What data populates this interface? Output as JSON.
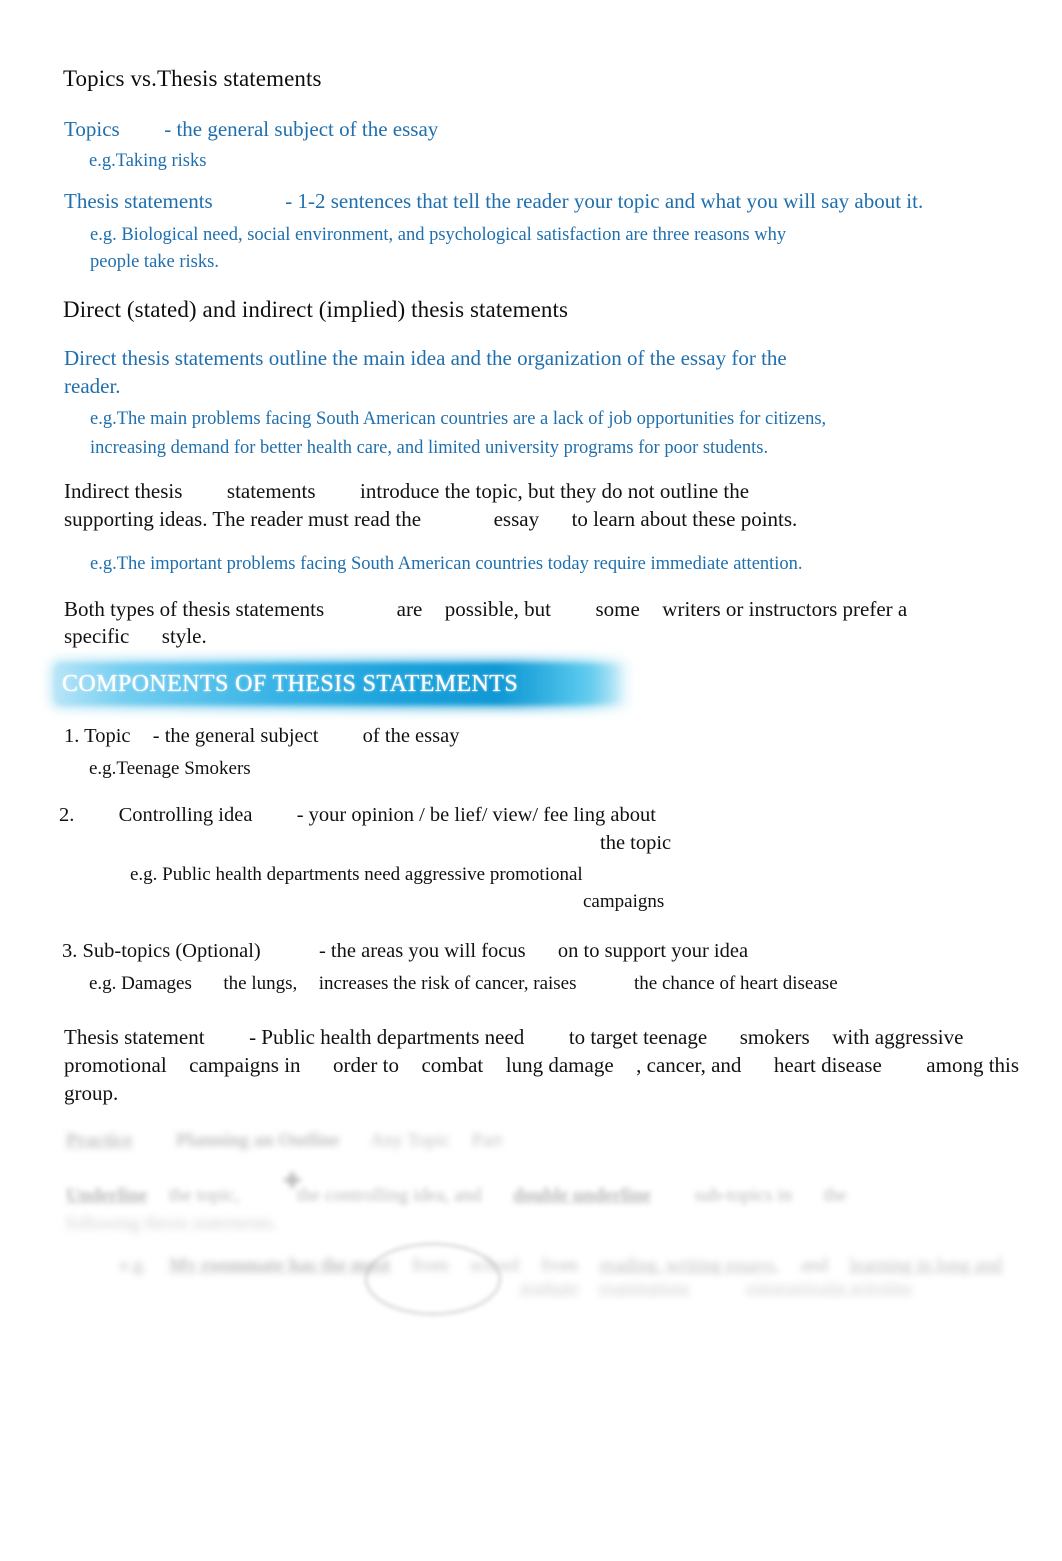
{
  "document": {
    "title": "Topics vs.Thesis statements",
    "accent_blue": "#1F6FAE",
    "banner_color_start": "#B6E4F7",
    "banner_color_end": "#1098D4",
    "text_color": "#111111"
  },
  "section_topics": {
    "heading": "Topics vs.Thesis statements",
    "topics_label": "Topics",
    "topics_definition": "- the general subject of the essay",
    "topics_example": "e.g.Taking risks",
    "thesis_label": "Thesis statements",
    "thesis_definition": "- 1-2 sentences that tell the reader your topic and what you will say about it.",
    "thesis_example_line1": "e.g. Biological need, social environment, and psychological satisfaction are three reasons why",
    "thesis_example_line2": "people take risks."
  },
  "section_direct_indirect": {
    "heading": "Direct (stated) and indirect (implied) thesis statements",
    "direct_line1": "Direct thesis statements outline the main idea and the organization of the essay for the",
    "direct_line2": "reader.",
    "direct_example_line1": "e.g.The main problems facing South American countries are a lack of job opportunities for citizens,",
    "direct_example_line2": "increasing demand for better health care, and limited university programs for poor students.",
    "indirect_part1": "Indirect thesis",
    "indirect_part2": "statements",
    "indirect_part3": "introduce the topic, but they do not outline the",
    "indirect_line2_part1": "supporting ideas. The reader must read the",
    "indirect_line2_part2": "essay",
    "indirect_line2_part3": "to learn about these points.",
    "indirect_example": "e.g.The important problems facing South American countries today require immediate attention.",
    "both_part1": "Both types of thesis statements",
    "both_part2": "are",
    "both_part3": "possible, but",
    "both_part4": "some",
    "both_part5": "writers or instructors prefer a",
    "both_line2_part1": "specific",
    "both_line2_part2": "style."
  },
  "section_components": {
    "banner_title": "COMPONENTS OF THESIS STATEMENTS",
    "item1_number": "1.",
    "item1_label": "Topic",
    "item1_def_part1": "- the general subject",
    "item1_def_part2": "of the essay",
    "item1_example": "e.g.Teenage Smokers",
    "item2_number": "2.",
    "item2_label": "Controlling idea",
    "item2_def": "- your  opinion / be lief/ view/ fee ling about",
    "item2_def_line2": "the topic",
    "item2_example_line1": "e.g. Public health departments need aggressive promotional",
    "item2_example_line2": "campaigns",
    "item3_number": "3.",
    "item3_label": "Sub-topics (Optional)",
    "item3_def_part1": "- the areas you will focus",
    "item3_def_part2": "on to  support your idea",
    "item3_example_part1": "e.g. Damages",
    "item3_example_part2": "the lungs,",
    "item3_example_part3": "increases the risk of cancer, raises",
    "item3_example_part4": "the  chance of heart disease"
  },
  "section_final_thesis": {
    "label": "Thesis statement",
    "line1_part1": "- Public health departments need",
    "line1_part2": "to target teenage",
    "line1_part3": "smokers",
    "line1_part4": "with aggressive",
    "line2_part1": "promotional",
    "line2_part2": "campaigns in",
    "line2_part3": "order to",
    "line2_part4": "combat",
    "line2_part5": "lung damage",
    "line2_part6": ", cancer, and",
    "line2_part7": "heart disease",
    "line2_part8": "among this",
    "line3": "group."
  },
  "section_blurred": {
    "note": "illegible blurred text at bottom of page",
    "line1_word1": "Practice",
    "line1_word2": "Planning an Outline",
    "line1_word3": "Any Topic",
    "line1_word4": "Part",
    "line2_word1": "Underline",
    "line2_word2": "the topic,",
    "line2_word3": "the controlling idea, and",
    "line2_word4": "double underline",
    "line2_word5": "sub-topics in",
    "line2_word6": "the",
    "line3_word1": "following thesis statements.",
    "line4_word1": "e.g.",
    "line4_word2": "My roommate has the most",
    "line4_word3": "from",
    "line4_word4": "school",
    "line4_word5": "from",
    "line4_word6": "reading, writing essays,",
    "line4_word7": "and",
    "line4_word8": "learning in long and",
    "line4_word9": "graduate",
    "line4_word10": "examinations",
    "line4_word11": "extracurricular activities"
  }
}
